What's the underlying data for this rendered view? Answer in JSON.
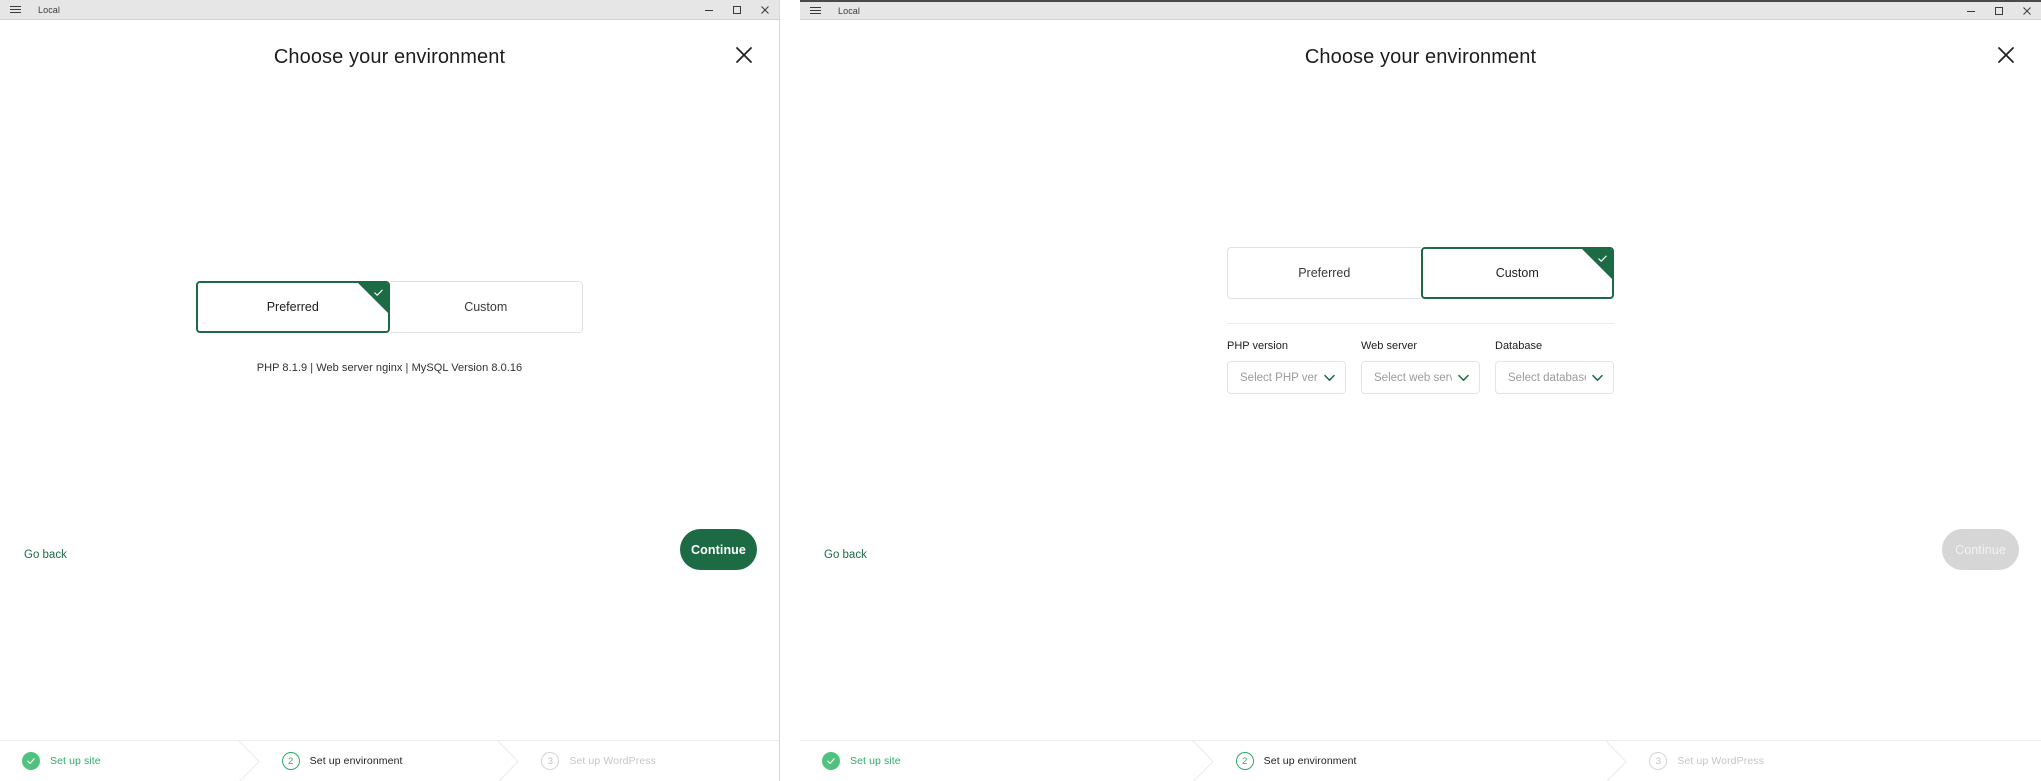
{
  "windows": [
    {
      "id": "left",
      "titlebar": {
        "title": "Local",
        "menu_icon": "hamburger-icon",
        "controls": {
          "minimize": "minimize-icon",
          "maximize": "maximize-icon",
          "close": "close-icon"
        }
      },
      "header": {
        "title": "Choose your environment",
        "close_icon": "close-icon"
      },
      "segmented": {
        "options": [
          {
            "label": "Preferred",
            "selected": true
          },
          {
            "label": "Custom",
            "selected": false
          }
        ],
        "check_icon": "check-icon"
      },
      "env_summary": "PHP 8.1.9 | Web server nginx | MySQL Version 8.0.16",
      "selects": [],
      "actions": {
        "go_back": "Go back",
        "continue": "Continue",
        "continue_enabled": true
      },
      "stepper": [
        {
          "badge": "✓",
          "label": "Set up site",
          "state": "done"
        },
        {
          "badge": "2",
          "label": "Set up environment",
          "state": "active"
        },
        {
          "badge": "3",
          "label": "Set up WordPress",
          "state": "todo"
        }
      ]
    },
    {
      "id": "right",
      "titlebar": {
        "title": "Local",
        "menu_icon": "hamburger-icon",
        "controls": {
          "minimize": "minimize-icon",
          "maximize": "maximize-icon",
          "close": "close-icon"
        }
      },
      "header": {
        "title": "Choose your environment",
        "close_icon": "close-icon"
      },
      "segmented": {
        "options": [
          {
            "label": "Preferred",
            "selected": false
          },
          {
            "label": "Custom",
            "selected": true
          }
        ],
        "check_icon": "check-icon"
      },
      "env_summary": "",
      "selects": [
        {
          "label": "PHP version",
          "placeholder": "Select PHP versi...",
          "value": "",
          "caret": "chevron-down-icon"
        },
        {
          "label": "Web server",
          "placeholder": "Select web server",
          "value": "",
          "caret": "chevron-down-icon"
        },
        {
          "label": "Database",
          "placeholder": "Select database",
          "value": "",
          "caret": "chevron-down-icon"
        }
      ],
      "actions": {
        "go_back": "Go back",
        "continue": "Continue",
        "continue_enabled": false
      },
      "stepper": [
        {
          "badge": "✓",
          "label": "Set up site",
          "state": "done"
        },
        {
          "badge": "2",
          "label": "Set up environment",
          "state": "active"
        },
        {
          "badge": "3",
          "label": "Set up WordPress",
          "state": "todo"
        }
      ]
    }
  ],
  "colors": {
    "brand_green": "#1d6b45",
    "step_green": "#2fab68",
    "step_done": "#4fc27f",
    "titlebar_bg": "#e6e6e6",
    "disabled_gray": "#d6d6d6"
  }
}
